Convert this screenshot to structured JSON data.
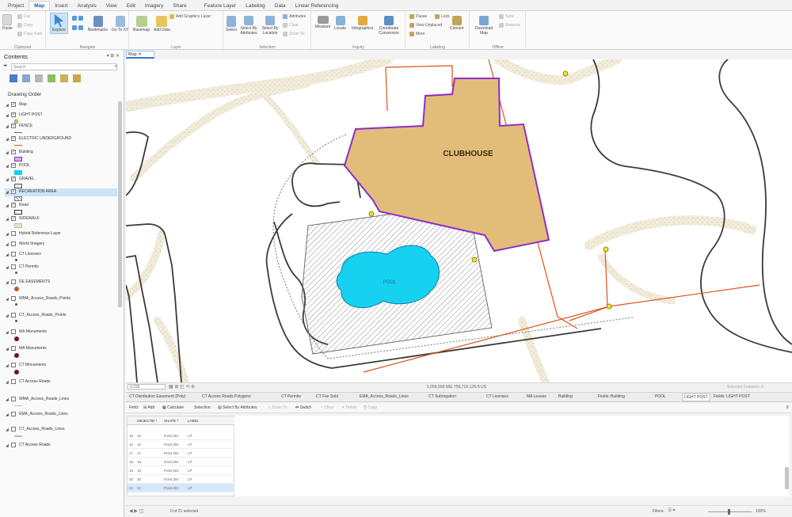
{
  "ribbon": {
    "tabs": [
      "Project",
      "Map",
      "Insert",
      "Analysis",
      "View",
      "Edit",
      "Imagery",
      "Share",
      "Feature Layer",
      "Labeling",
      "Data",
      "Linear Referencing"
    ],
    "active_tab": "Map",
    "clipboard": {
      "paste": "Paste",
      "cut": "Cut",
      "copy": "Copy",
      "copy_path": "Copy Path",
      "group": "Clipboard"
    },
    "navigate": {
      "explore": "Explore",
      "bookmarks": "Bookmarks",
      "go_to_xy": "Go To XY",
      "group": "Navigate"
    },
    "layer": {
      "basemap": "Basemap",
      "add_data": "Add Data",
      "add_graphics_layer": "Add Graphics Layer",
      "group": "Layer"
    },
    "selection": {
      "select": "Select",
      "select_by_attributes": "Select By Attributes",
      "select_by_location": "Select By Location",
      "attributes": "Attributes",
      "clear": "Clear",
      "zoom_to": "Zoom To",
      "group": "Selection"
    },
    "inquiry": {
      "measure": "Measure",
      "locate": "Locate",
      "infographics": "Infographics",
      "coordinate_conversion": "Coordinate Conversion",
      "group": "Inquiry"
    },
    "labeling": {
      "pause": "Pause",
      "lock": "Lock",
      "view_unplaced": "View Unplaced",
      "more": "More",
      "convert": "Convert",
      "group": "Labeling"
    },
    "offline": {
      "download_map": "Download Map",
      "sync": "Sync",
      "remove": "Remove",
      "group": "Offline"
    }
  },
  "contents": {
    "title": "Contents",
    "controls": "▾ ⊞ ✕",
    "search_placeholder": "Search",
    "drawing_order": "Drawing Order",
    "layers": [
      {
        "name": "Map",
        "checked": true,
        "symbol": "map"
      },
      {
        "name": "LIGHT POST",
        "checked": true,
        "symbol": "point-yellow"
      },
      {
        "name": "FENCE",
        "checked": true,
        "symbol": "line-gray"
      },
      {
        "name": "ELECTRIC UNDERGROUND",
        "checked": true,
        "symbol": "line-orange"
      },
      {
        "name": "Building",
        "checked": true,
        "symbol": "fill-purple"
      },
      {
        "name": "POOL",
        "checked": true,
        "symbol": "fill-cyan"
      },
      {
        "name": "GRAVEL",
        "checked": true,
        "symbol": "fill-gray-outline"
      },
      {
        "name": "RECREATION AREA",
        "checked": true,
        "symbol": "hatch"
      },
      {
        "name": "Road",
        "checked": true,
        "symbol": "fill-outline-dark"
      },
      {
        "name": "SIDEWALK",
        "checked": true,
        "symbol": "pattern-tan"
      },
      {
        "name": "Hybrid Reference Layer",
        "checked": false,
        "symbol": ""
      },
      {
        "name": "World Imagery",
        "checked": false,
        "symbol": ""
      },
      {
        "name": "CT Licenses",
        "checked": false,
        "symbol": "dot-small"
      },
      {
        "name": "CT Permits",
        "checked": false,
        "symbol": "dot-small"
      },
      {
        "name": "DE EASEMENTS",
        "checked": false,
        "symbol": "dot-orange"
      },
      {
        "name": "WMA_Access_Roads_Points",
        "checked": false,
        "symbol": "dot-small"
      },
      {
        "name": "CT_Access_Roads_Points",
        "checked": false,
        "symbol": "dot-small"
      },
      {
        "name": "Wh Monuments",
        "checked": false,
        "symbol": "dot-darkred"
      },
      {
        "name": "MA Monuments",
        "checked": false,
        "symbol": "dot-darkred"
      },
      {
        "name": "CT Monuments",
        "checked": false,
        "symbol": "dot-darkred"
      },
      {
        "name": "CT Access Roads",
        "checked": false,
        "symbol": ""
      },
      {
        "name": "WMA_Access_Roads_Lines",
        "checked": false,
        "symbol": "line-light"
      },
      {
        "name": "EMA_Access_Roads_Lines",
        "checked": false,
        "symbol": ""
      },
      {
        "name": "CT_Access_Roads_Lines",
        "checked": false,
        "symbol": "line-blue"
      },
      {
        "name": "CT Access Roads",
        "checked": false,
        "symbol": ""
      }
    ],
    "selected_layer": "RECREATION AREA"
  },
  "map": {
    "tab_label": "Map",
    "labels": {
      "clubhouse": "CLUBHOUSE",
      "pool": "POOL"
    },
    "scale": "1:226",
    "coordinates": "1,058,508.58E 758,718.12N ft US",
    "selected_features": "Selected Features: 0"
  },
  "attribute_tabs": [
    "CT Distribution Easement (Poly)",
    "CT Access Roads Polygons",
    "CT Permits",
    "CT Fee Sold",
    "EMA_Access_Roads_Lines",
    "CT Subrogation",
    "CT Licenses",
    "MA Leases",
    "Building",
    "Fields: Building",
    "POOL",
    "LIGHT POST",
    "Fields: LIGHT POST"
  ],
  "active_attribute_tab": "LIGHT POST",
  "attribute_toolbar": {
    "field": "Field:",
    "add": "Add",
    "calculate": "Calculate",
    "selection": "Selection:",
    "select_by_attributes": "Select By Attributes",
    "zoom_to": "Zoom To",
    "switch": "Switch",
    "clear": "Clear",
    "delete": "Delete",
    "copy": "Copy"
  },
  "table": {
    "columns": [
      "OBJECTID *",
      "SHAPE *",
      "LABEL"
    ],
    "rows": [
      {
        "row": "15",
        "objectid": "15",
        "shape": "Point ZM",
        "label": "LP"
      },
      {
        "row": "16",
        "objectid": "16",
        "shape": "Point ZM",
        "label": "LP"
      },
      {
        "row": "17",
        "objectid": "17",
        "shape": "Point ZM",
        "label": "LP"
      },
      {
        "row": "18",
        "objectid": "18",
        "shape": "Point ZM",
        "label": "LP"
      },
      {
        "row": "19",
        "objectid": "19",
        "shape": "Point ZM",
        "label": "LP"
      },
      {
        "row": "20",
        "objectid": "20",
        "shape": "Point ZM",
        "label": "LP"
      },
      {
        "row": "21",
        "objectid": "21",
        "shape": "Point ZM",
        "label": "LP"
      }
    ],
    "selected_row": "21",
    "status": "0 of 21 selected",
    "filters": "Filters:",
    "zoom": "100%"
  },
  "colors": {
    "building_fill": "#e2bd7a",
    "building_outline": "#8a2fc9",
    "pool_fill": "#14d1f0",
    "electric_line": "#d9541e",
    "light_post": "#f4e41c",
    "sidewalk": "#e9e0c5",
    "accent": "#2d7dd2"
  }
}
